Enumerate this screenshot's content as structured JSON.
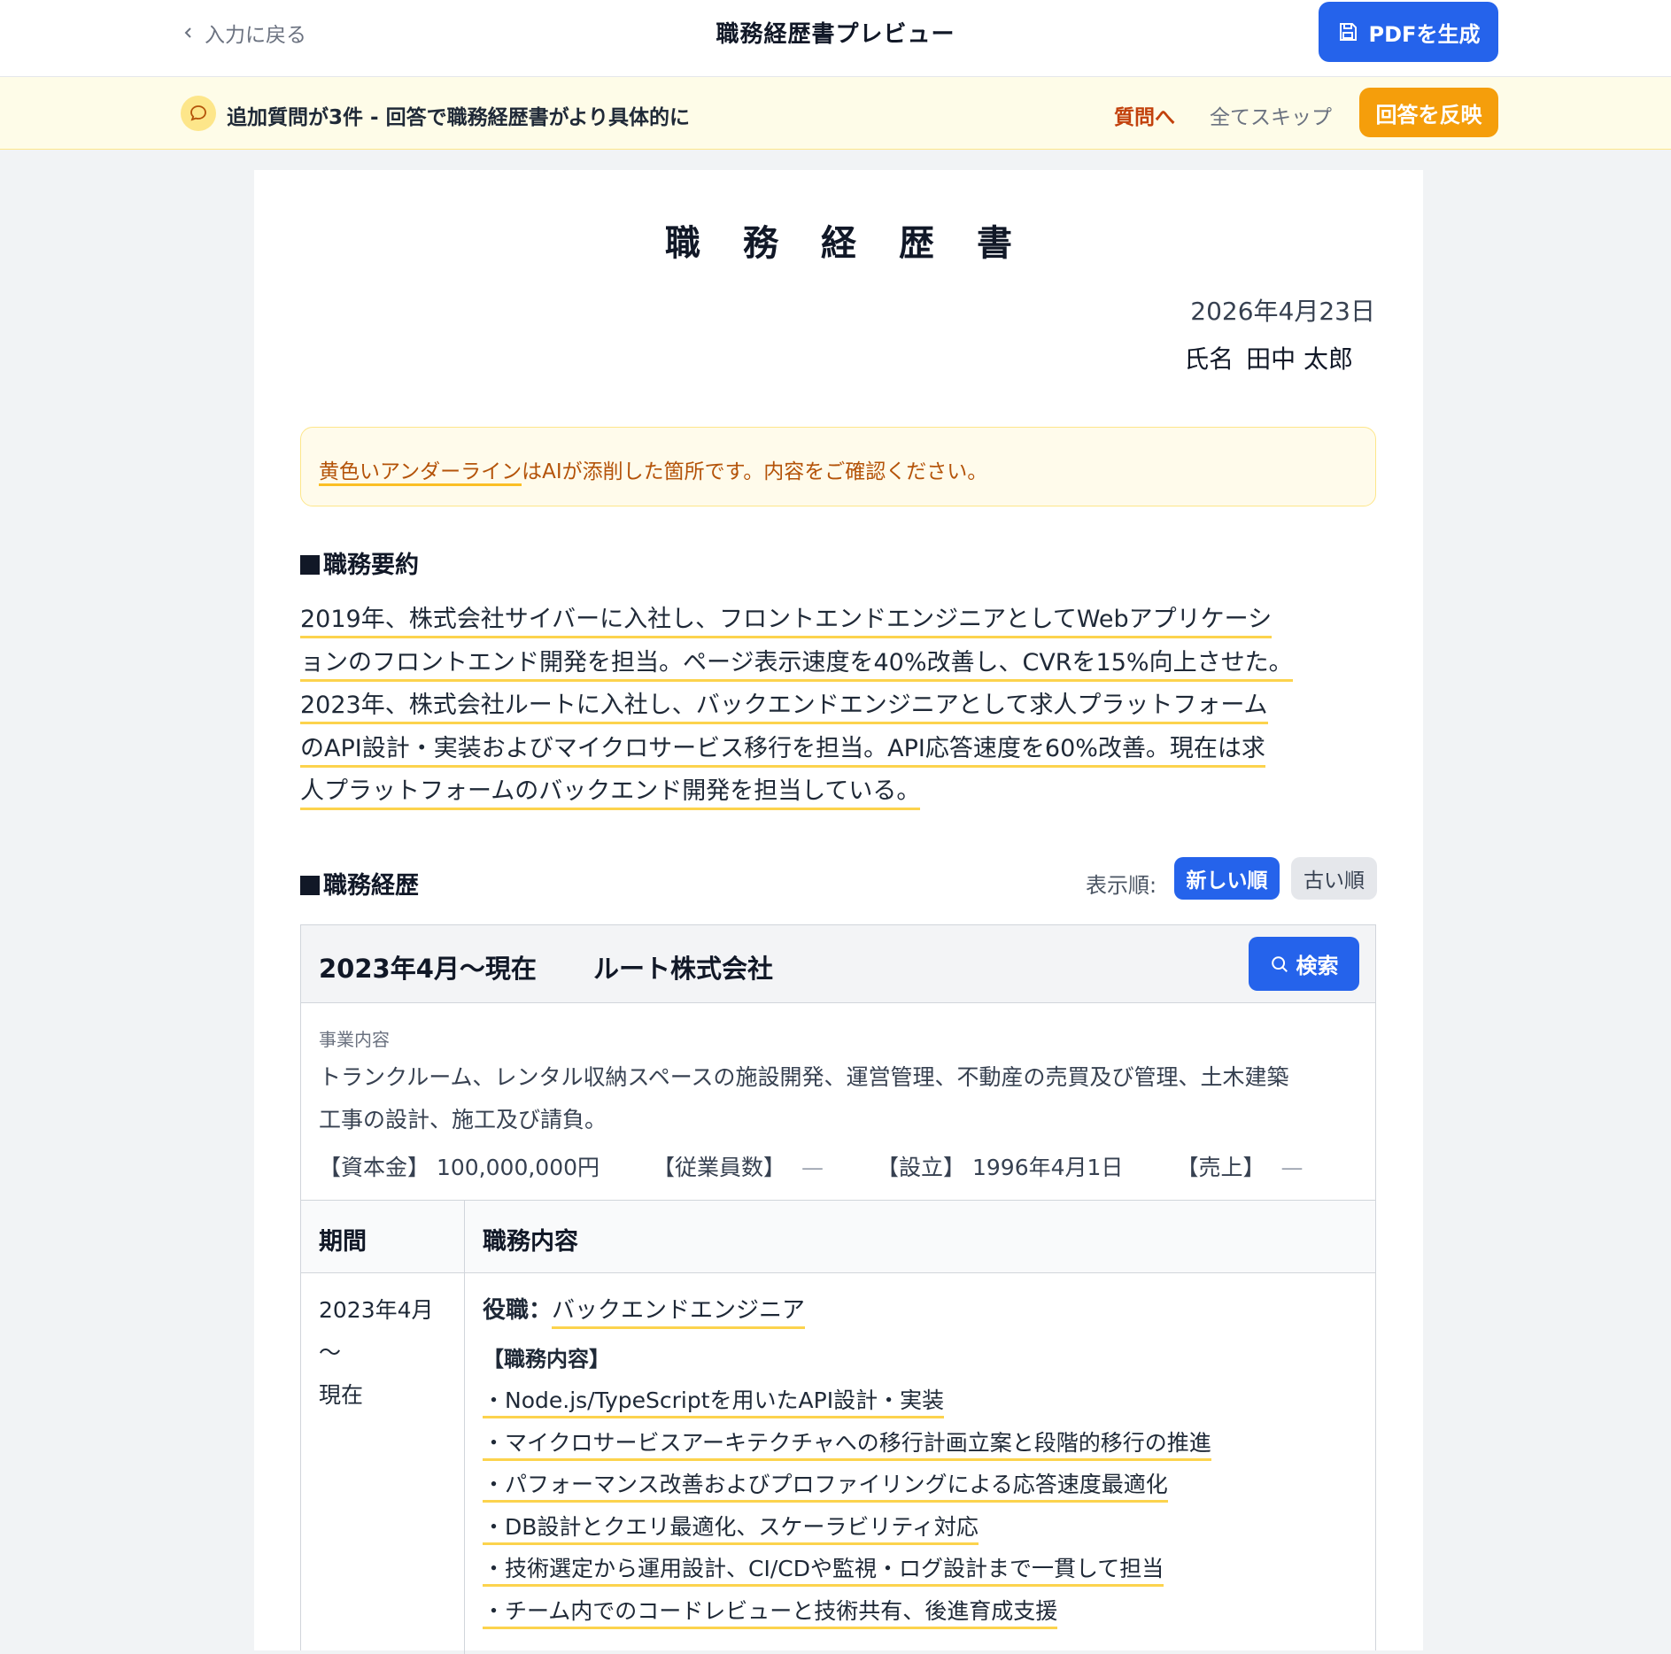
{
  "header": {
    "back_label": "入力に戻る",
    "title": "職務経歴書プレビュー",
    "pdf_label": "PDFを生成"
  },
  "notice": {
    "text": "追加質問が3件 - 回答で職務経歴書がより具体的に",
    "questions_link": "質問へ",
    "skip_all": "全てスキップ",
    "reflect_label": "回答を反映"
  },
  "document": {
    "title": "職務経歴書",
    "date": "2026年4月23日",
    "name_label": "氏名",
    "name": "田中 太郎",
    "ai_note": {
      "highlight": "黄色いアンダーライン",
      "rest": "はAIが添削した箇所です。内容をご確認ください。"
    },
    "summary_heading": "職務要約",
    "summary_lines": [
      "2019年、株式会社サイバーに入社し、フロントエンドエンジニアとしてWebアプリケーシ",
      "ョンのフロントエンド開発を担当。ページ表示速度を40%改善し、CVRを15%向上させた。",
      "2023年、株式会社ルートに入社し、バックエンドエンジニアとして求人プラットフォーム",
      "のAPI設計・実装およびマイクロサービス移行を担当。API応答速度を60%改善。現在は求",
      "人プラットフォームのバックエンド開発を担当している。"
    ],
    "history_heading": "職務経歴",
    "sort": {
      "label": "表示順:",
      "newest": "新しい順",
      "oldest": "古い順"
    },
    "company": {
      "period": "2023年4月〜現在",
      "name": "ルート株式会社",
      "search_label": "検索",
      "business_label": "事業内容",
      "business_lines": [
        "トランクルーム、レンタル収納スペースの施設開発、運営管理、不動産の売買及び管理、土木建築",
        "工事の設計、施工及び請負。"
      ],
      "capital_label": "【資本金】",
      "capital": "100,000,000円",
      "employees_label": "【従業員数】",
      "employees": "—",
      "founded_label": "【設立】",
      "founded": "1996年4月1日",
      "sales_label": "【売上】",
      "sales": "—",
      "col_period": "期間",
      "col_duty": "職務内容",
      "row": {
        "period_lines": [
          "2023年4月",
          "〜",
          "現在"
        ],
        "role_label": "役職：",
        "role": "バックエンドエンジニア",
        "duty_heading": "【職務内容】",
        "duties": [
          "・Node.js/TypeScriptを用いたAPI設計・実装",
          "・マイクロサービスアーキテクチャへの移行計画立案と段階的移行の推進",
          "・パフォーマンス改善およびプロファイリングによる応答速度最適化",
          "・DB設計とクエリ最適化、スケーラビリティ対応",
          "・技術選定から運用設計、CI/CDや監視・ログ設計まで一貫して担当",
          "・チーム内でのコードレビューと技術共有、後進育成支援"
        ]
      }
    }
  },
  "colors": {
    "primary": "#2563eb",
    "accent_orange": "#f59e0b",
    "highlight_underline": "#fcd34d"
  }
}
